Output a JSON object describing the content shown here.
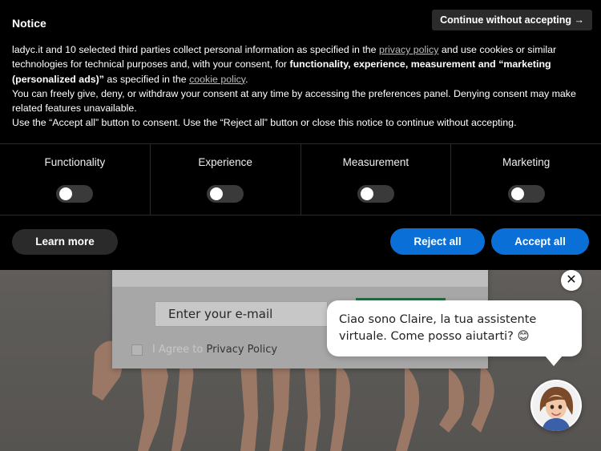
{
  "notice": {
    "title": "Notice",
    "continue_label": "Continue without accepting →",
    "p1_a": "ladyc.it and 10 selected third parties collect personal information as specified in the ",
    "privacy_link": "privacy policy",
    "p1_b": " and use cookies or similar technologies for technical purposes and, with your consent, for ",
    "p1_bold": "functionality, experience, measurement and “marketing (personalized ads)”",
    "p1_c": " as specified in the ",
    "cookie_link": "cookie policy",
    "p1_d": ".",
    "p2": "You can freely give, deny, or withdraw your consent at any time by accessing the preferences panel. Denying consent may make related features unavailable.",
    "p3": "Use the “Accept all” button to consent. Use the “Reject all” button or close this notice to continue without accepting."
  },
  "preferences": [
    {
      "label": "Functionality",
      "enabled": false
    },
    {
      "label": "Experience",
      "enabled": false
    },
    {
      "label": "Measurement",
      "enabled": false
    },
    {
      "label": "Marketing",
      "enabled": false
    }
  ],
  "buttons": {
    "learn_more": "Learn more",
    "reject_all": "Reject all",
    "accept_all": "Accept all"
  },
  "newsletter": {
    "email_placeholder": "Enter your e-mail",
    "agree_prefix": "I Agree to ",
    "agree_link": "Privacy Policy"
  },
  "chat": {
    "message": "Ciao sono Claire, la tua assistente virtuale. Come posso aiutarti? 😊",
    "close_symbol": "✕"
  },
  "colors": {
    "banner_bg": "#000000",
    "primary_button": "#0a6fd6",
    "secondary_button": "#2a2a2a"
  }
}
